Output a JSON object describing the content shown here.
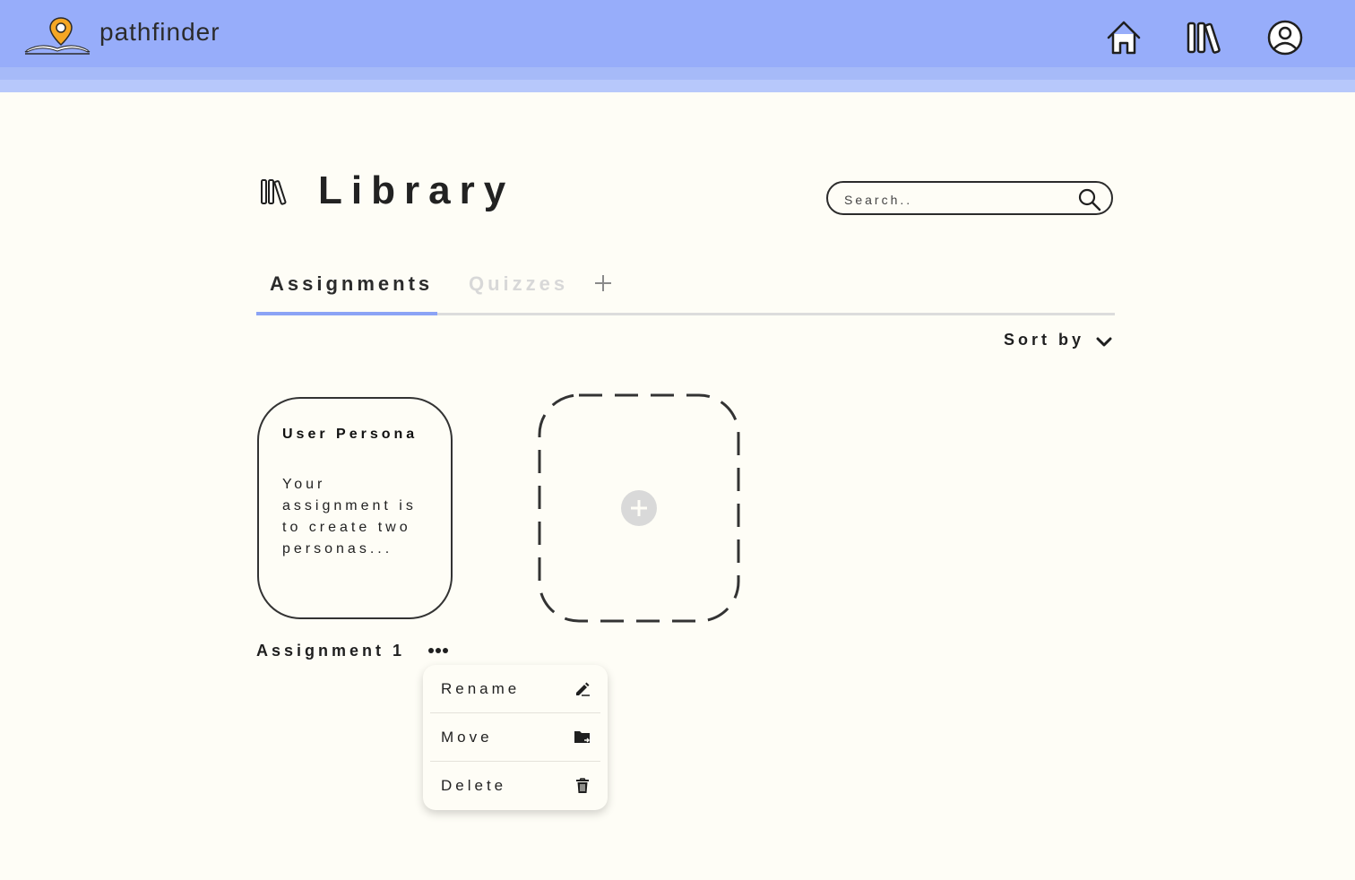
{
  "app": {
    "brand": "pathfinder"
  },
  "nav": {
    "items": [
      "home-icon",
      "library-icon",
      "profile-icon"
    ]
  },
  "page": {
    "title": "Library"
  },
  "search": {
    "placeholder": "Search.."
  },
  "tabs": [
    {
      "label": "Assignments",
      "active": true
    },
    {
      "label": "Quizzes",
      "active": false
    }
  ],
  "sort": {
    "label": "Sort by"
  },
  "cards": [
    {
      "title": "User Persona",
      "description": "Your assignment is to create two personas...",
      "label": "Assignment 1"
    }
  ],
  "context_menu": {
    "items": [
      {
        "label": "Rename",
        "icon": "edit-icon"
      },
      {
        "label": "Move",
        "icon": "folder-move-icon"
      },
      {
        "label": "Delete",
        "icon": "trash-icon"
      }
    ]
  },
  "colors": {
    "header": "#97adfa",
    "accent": "#8ba3f5",
    "background": "#fefdf6",
    "logo_pin": "#f5a623"
  }
}
